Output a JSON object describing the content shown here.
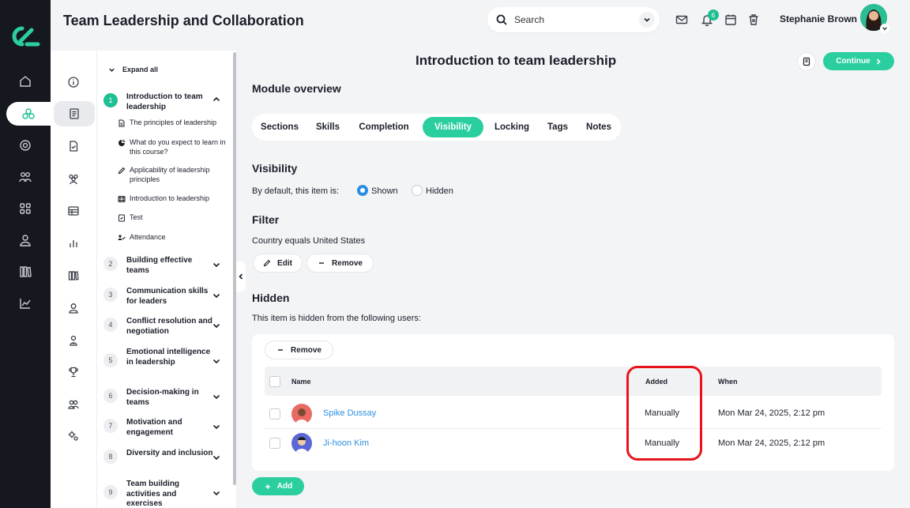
{
  "header": {
    "title": "Team Leadership and Collaboration",
    "search_placeholder": "Search",
    "notification_count": "6",
    "user_name": "Stephanie Brown"
  },
  "rail_icons": [
    "home-icon",
    "courses-icon",
    "target-icon",
    "groups-icon",
    "apps-icon",
    "user-icon",
    "library-icon",
    "analytics-icon"
  ],
  "outline": {
    "expand_all": "Expand all",
    "sections": [
      {
        "num": "1",
        "title": "Introduction to team leadership",
        "expanded": true
      },
      {
        "num": "2",
        "title": "Building effective teams"
      },
      {
        "num": "3",
        "title": "Communication skills for leaders"
      },
      {
        "num": "4",
        "title": "Conflict resolution and negotiation"
      },
      {
        "num": "5",
        "title": "Emotional intelligence in leadership"
      },
      {
        "num": "6",
        "title": "Decision-making in teams"
      },
      {
        "num": "7",
        "title": "Motivation and engagement"
      },
      {
        "num": "8",
        "title": "Diversity and inclusion"
      },
      {
        "num": "9",
        "title": "Team building activities and exercises"
      }
    ],
    "items": [
      {
        "icon": "document-icon",
        "label": "The principles of leadership"
      },
      {
        "icon": "survey-icon",
        "label": "What do you expect to learn in this course?"
      },
      {
        "icon": "pencil-icon",
        "label": "Applicability of leadership principles"
      },
      {
        "icon": "video-icon",
        "label": "Introduction to leadership"
      },
      {
        "icon": "test-icon",
        "label": "Test"
      },
      {
        "icon": "attendance-icon",
        "label": "Attendance"
      }
    ]
  },
  "main": {
    "page_title": "Introduction to team leadership",
    "continue_label": "Continue",
    "module_overview": "Module overview",
    "tabs": [
      "Sections",
      "Skills",
      "Completion",
      "Visibility",
      "Locking",
      "Tags",
      "Notes"
    ],
    "active_tab": "Visibility",
    "visibility": {
      "heading": "Visibility",
      "default_label": "By default, this item is:",
      "shown": "Shown",
      "hidden": "Hidden",
      "selected": "Shown"
    },
    "filter": {
      "heading": "Filter",
      "rule": "Country equals United States",
      "edit": "Edit",
      "remove": "Remove"
    },
    "hidden": {
      "heading": "Hidden",
      "description": "This item is hidden from the following users:",
      "remove": "Remove",
      "columns": [
        "Name",
        "Added",
        "When"
      ],
      "rows": [
        {
          "name": "Spike Dussay",
          "added": "Manually",
          "when": "Mon Mar 24, 2025, 2:12 pm"
        },
        {
          "name": "Ji-hoon Kim",
          "added": "Manually",
          "when": "Mon Mar 24, 2025, 2:12 pm"
        }
      ]
    },
    "add_label": "Add"
  },
  "colors": {
    "accent": "#2bcf9f",
    "link": "#2d8fe3",
    "highlight": "#e8141c",
    "rail": "#16181f"
  }
}
